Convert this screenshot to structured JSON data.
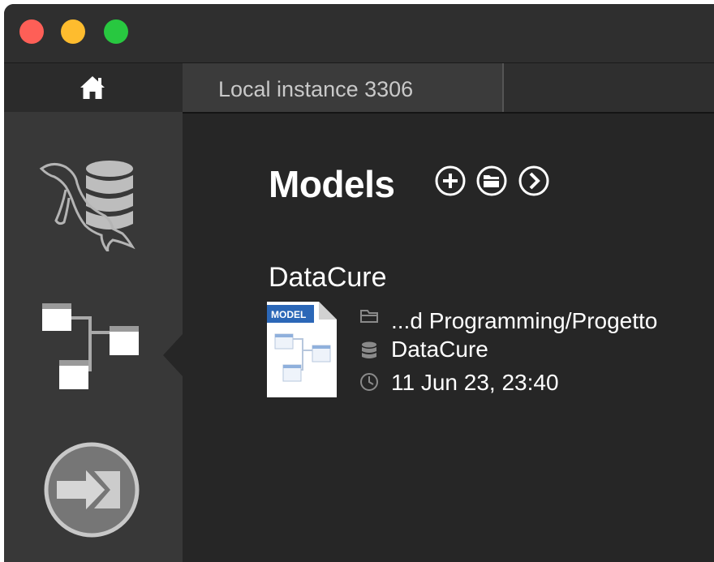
{
  "window": {
    "traffic_lights": [
      {
        "name": "close",
        "color": "#fe5f57"
      },
      {
        "name": "minimize",
        "color": "#febc2e"
      },
      {
        "name": "zoom",
        "color": "#28c840"
      }
    ]
  },
  "sidebar": {
    "home_icon": "home-icon",
    "items": [
      {
        "icon": "connections-icon"
      },
      {
        "icon": "models-icon",
        "selected": true
      },
      {
        "icon": "migration-icon"
      }
    ]
  },
  "tabs": [
    {
      "label": "Local instance 3306"
    }
  ],
  "main": {
    "section_title": "Models",
    "header_icons": [
      "add-model-icon",
      "open-model-icon",
      "browse-models-icon"
    ],
    "model": {
      "name": "DataCure",
      "doc_badge": "MODEL",
      "path": "...d Programming/Progetto",
      "schema": "DataCure",
      "last_modified": "11 Jun 23, 23:40"
    }
  }
}
